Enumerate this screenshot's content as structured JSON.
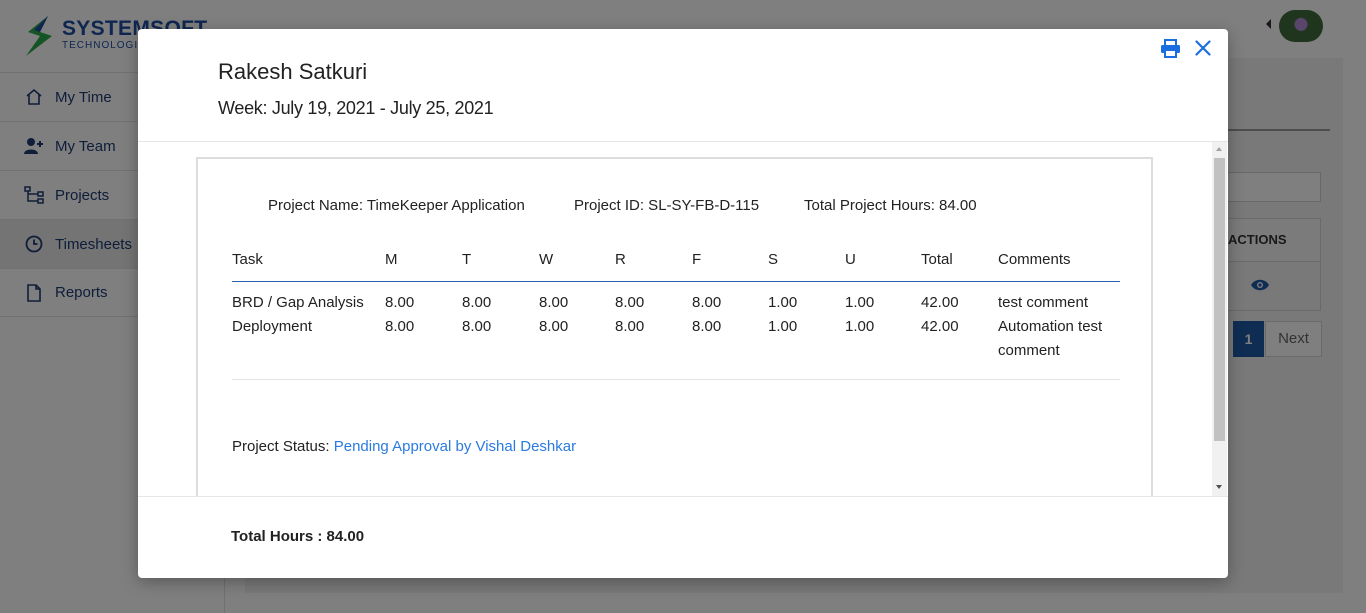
{
  "app": {
    "logo_title": "SYSTEMSOFT",
    "logo_subtitle": "TECHNOLOGIES",
    "nav": [
      {
        "label": "My Time",
        "icon": "home-icon"
      },
      {
        "label": "My Team",
        "icon": "add-user-icon"
      },
      {
        "label": "Projects",
        "icon": "sitemap-icon"
      },
      {
        "label": "Timesheets",
        "icon": "clock-icon",
        "active": true
      },
      {
        "label": "Reports",
        "icon": "file-icon"
      }
    ],
    "table_header_actions": "ACTIONS",
    "pagination": {
      "current_page": "1",
      "next_label": "Next"
    }
  },
  "modal": {
    "employee_name": "Rakesh Satkuri",
    "week": "Week: July 19, 2021 - July 25, 2021",
    "project": {
      "name": "Project Name: TimeKeeper Application",
      "id": "Project ID: SL-SY-FB-D-115",
      "total": "Total Project Hours: 84.00",
      "columns": [
        "Task",
        "M",
        "T",
        "W",
        "R",
        "F",
        "S",
        "U",
        "Total",
        "Comments"
      ],
      "rows": [
        {
          "task": "BRD / Gap Analysis",
          "m": "8.00",
          "t": "8.00",
          "w": "8.00",
          "r": "8.00",
          "f": "8.00",
          "s": "1.00",
          "u": "1.00",
          "total": "42.00",
          "comments": "test comment"
        },
        {
          "task": "Deployment",
          "m": "8.00",
          "t": "8.00",
          "w": "8.00",
          "r": "8.00",
          "f": "8.00",
          "s": "1.00",
          "u": "1.00",
          "total": "42.00",
          "comments": "Automation test comment"
        }
      ],
      "status_label": "Project Status:",
      "status_value": "Pending Approval by Vishal Deshkar"
    },
    "total_hours": "Total Hours : 84.00"
  },
  "colors": {
    "accent": "#1a6ee0",
    "brand": "#1e4fa0",
    "link": "#2a7ae0"
  }
}
